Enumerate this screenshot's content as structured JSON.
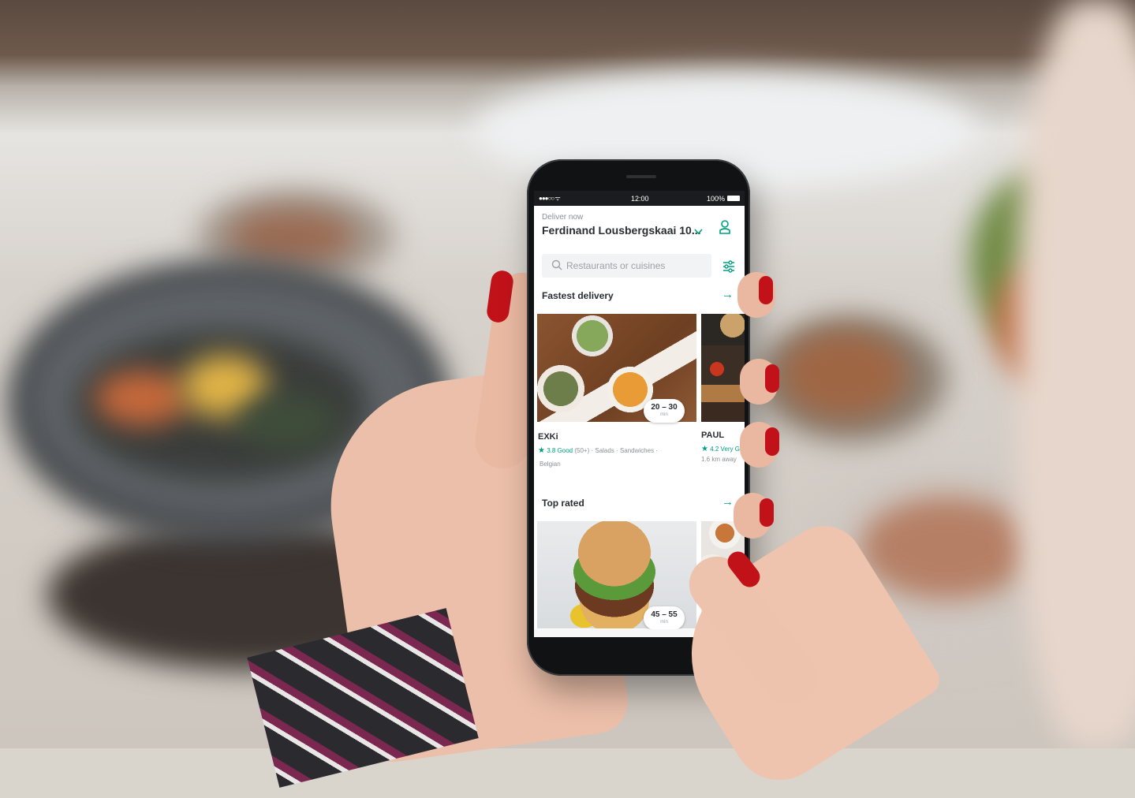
{
  "colors": {
    "accent": "#00a082",
    "text_dark": "#2a2d31",
    "text_muted": "#8a8f96",
    "nail_red": "#c1121a"
  },
  "statusbar": {
    "signal": "●●●○○ ᯤ",
    "time": "12:00",
    "battery": "100%"
  },
  "header": {
    "deliver_label": "Deliver now",
    "address": "Ferdinand Lousbergskaai 10...",
    "chevron_icon": "chevron-down-icon",
    "profile_icon": "person-icon"
  },
  "search": {
    "placeholder": "Restaurants or cuisines",
    "search_icon": "search-icon",
    "filter_icon": "filter-sliders-icon"
  },
  "sections": [
    {
      "title": "Fastest delivery",
      "arrow_icon": "arrow-right-icon",
      "restaurants": [
        {
          "name": "EXKi",
          "time_range": "20 – 30",
          "time_unit": "min",
          "rating": "3.8 Good",
          "meta_line1": "(50+) · Salads · Sandwiches ·",
          "meta_line2": "Belgian"
        },
        {
          "name": "PAUL",
          "rating": "4.2 Very G",
          "meta_line1": "1.6 km away"
        }
      ]
    },
    {
      "title": "Top rated",
      "arrow_icon": "arrow-right-icon",
      "restaurants": [
        {
          "time_range": "45 – 55",
          "time_unit": "min"
        }
      ]
    }
  ]
}
